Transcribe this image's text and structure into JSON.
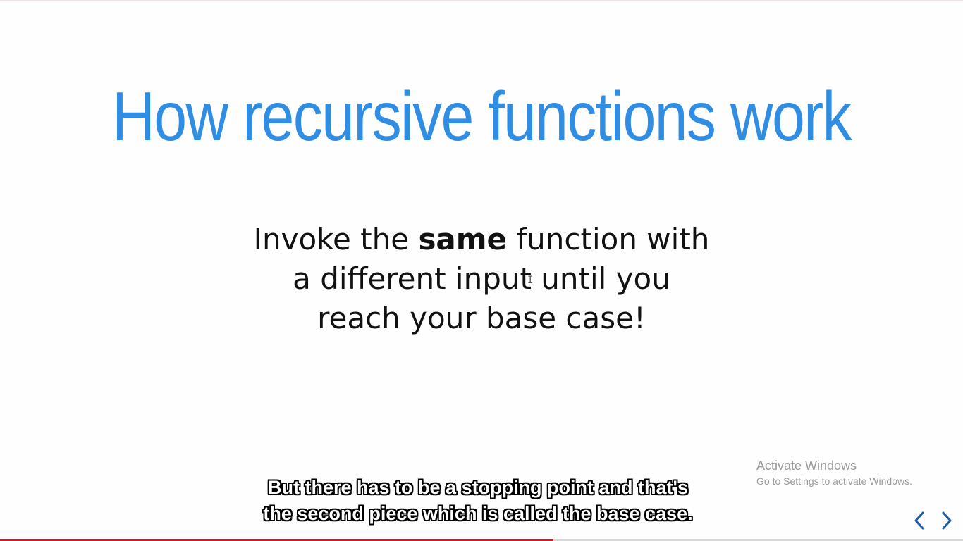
{
  "slide": {
    "title": "How recursive functions work",
    "body": {
      "line1_pre": "Invoke the ",
      "line1_bold": "same",
      "line1_post": " function with",
      "line2": "a different input until you",
      "line3": "reach your base case!"
    }
  },
  "caption": {
    "line1": "But there has to be a stopping point and that's",
    "line2": "the second piece which is called the base case."
  },
  "watermark": {
    "title": "Activate Windows",
    "subtitle": "Go to Settings to activate Windows."
  },
  "navigation": {
    "prev_icon": "chevron-left-icon",
    "next_icon": "chevron-right-icon"
  },
  "player": {
    "progress_fraction": 0.575
  },
  "colors": {
    "title": "#2f8de4",
    "progress": "#d61a2a",
    "nav_arrows": "#1e5ca8"
  }
}
